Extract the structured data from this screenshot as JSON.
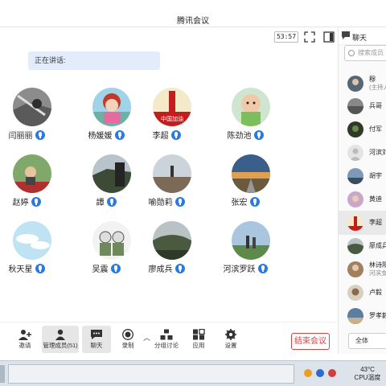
{
  "window": {
    "title": "腾讯会议"
  },
  "toolstrip": {
    "timer": "53:57"
  },
  "main": {
    "speaking_label": "正在讲话:"
  },
  "participants": [
    {
      "name": "闫丽丽"
    },
    {
      "name": "杨媛媛"
    },
    {
      "name": "李超",
      "avatar_text": "中国加油"
    },
    {
      "name": "陈劲池"
    },
    {
      "name": "赵婷"
    },
    {
      "name": "譚"
    },
    {
      "name": "喻勋莉"
    },
    {
      "name": "张宏"
    },
    {
      "name": "秋天星"
    },
    {
      "name": "吴震"
    },
    {
      "name": "廖成兵"
    },
    {
      "name": "河滨罗跃"
    }
  ],
  "toolbar": {
    "invite": "邀请",
    "manage_members": "管理成员(51)",
    "chat": "聊天",
    "record": "录制",
    "breakout": "分组讨论",
    "apps": "应用",
    "settings": "设置",
    "end_meeting": "结束会议"
  },
  "sidebar": {
    "tab_chat": "聊天",
    "search_placeholder": "搜索成员",
    "members": [
      {
        "name": "穆",
        "sub": "(主持人"
      },
      {
        "name": "兵哥"
      },
      {
        "name": "付军"
      },
      {
        "name": "河滨刘"
      },
      {
        "name": "胡宇"
      },
      {
        "name": "黄迪"
      },
      {
        "name": "李超"
      },
      {
        "name": "廖成兵"
      },
      {
        "name": "林诗阳",
        "sub": "河滨支"
      },
      {
        "name": "卢毅"
      },
      {
        "name": "罗孝毅"
      }
    ],
    "all_button": "全体"
  },
  "taskbar": {
    "temperature": "43°C",
    "cpu_label": "CPU温度"
  }
}
